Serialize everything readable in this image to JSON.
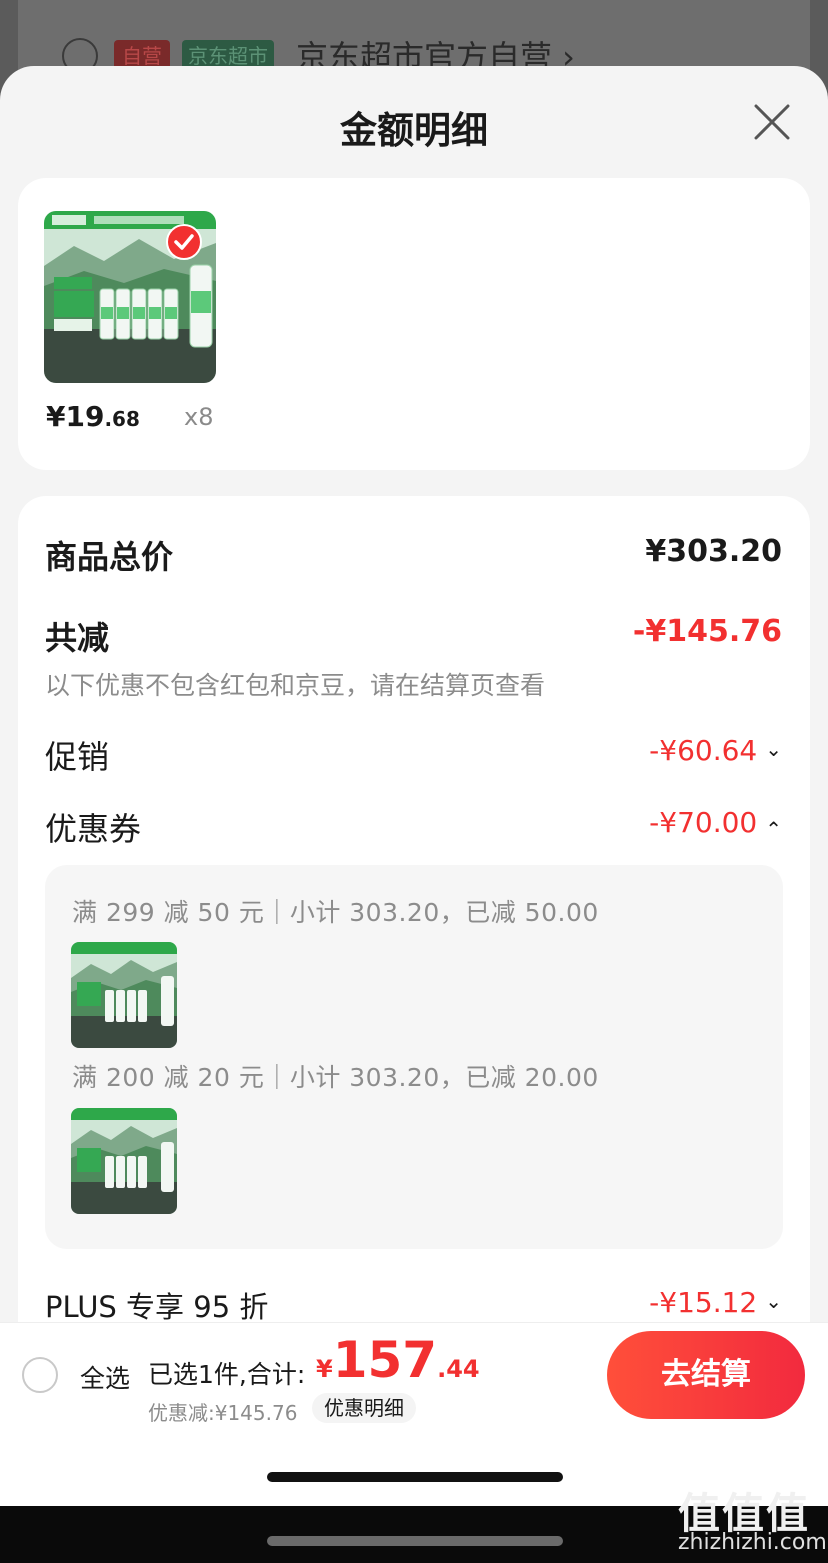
{
  "background_header": {
    "tag_self": "自营",
    "tag_market": "京东超市",
    "store_name": "京东超市官方自营 ›"
  },
  "sheet": {
    "title": "金额明细",
    "close_icon": "close-icon"
  },
  "product": {
    "price_int": "¥19",
    "price_dec": ".68",
    "quantity": "x8",
    "selected": true
  },
  "summary": {
    "total_label": "商品总价",
    "total_value": "¥303.20",
    "reduce_label": "共减",
    "reduce_value": "-¥145.76",
    "note": "以下优惠不包含红包和京豆，请在结算页查看",
    "promo_label": "促销",
    "promo_value": "-¥60.64",
    "coupon_label": "优惠券",
    "coupon_value": "-¥70.00",
    "plus_label": "PLUS 专享 95 折",
    "plus_value": "-¥15.12"
  },
  "coupons": [
    {
      "text": "满 299 减 50 元｜小计 303.20，已减 50.00"
    },
    {
      "text": "满 200 减 20 元｜小计 303.20，已减 20.00"
    }
  ],
  "bottom_bar": {
    "select_all": "全选",
    "selected_text": "已选1件,合计:",
    "currency": "¥",
    "total_int": "157",
    "total_dec": ".44",
    "discount_text": "优惠减:¥145.76",
    "detail_chip": "优惠明细",
    "checkout": "去结算"
  },
  "watermark": {
    "logo": "值值值",
    "url": "zhizhizhi.com"
  },
  "colors": {
    "accent_red": "#f23030",
    "sheet_bg": "#f4f4f4",
    "card_bg": "#ffffff"
  }
}
